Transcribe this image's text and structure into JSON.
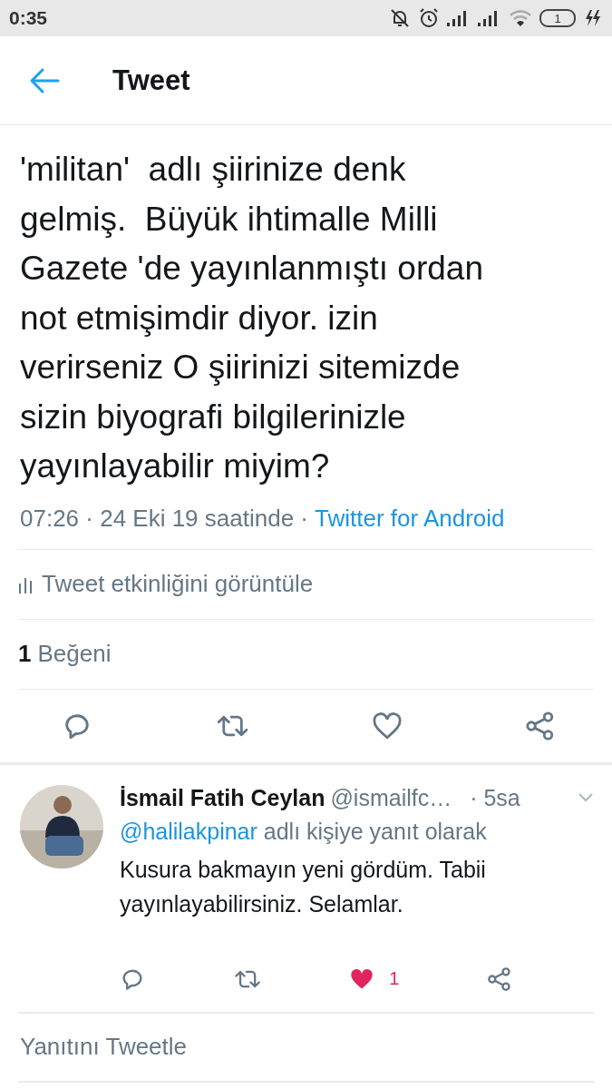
{
  "status_bar": {
    "time": "0:35",
    "battery": "1"
  },
  "header": {
    "title": "Tweet"
  },
  "tweet": {
    "body_lines": [
      "'militan'  adlı şiirinize denk",
      "gelmiş.  Büyük ihtimalle Milli",
      "Gazete 'de yayınlanmıştı ordan",
      "not etmişimdir diyor. izin",
      "verirseniz O şiirinizi sitemizde",
      "sizin biyografi bilgilerinizle",
      "yayınlayabilir miyim?"
    ],
    "timestamp": "07:26 · 24 Eki 19 saatinde ·",
    "source": "Twitter for Android",
    "activity_link": "Tweet etkinliğini görüntüle",
    "like_count": "1",
    "like_label": "Beğeni",
    "liked": false
  },
  "reply": {
    "name": "İsmail Fatih Ceylan",
    "handle": "@ismailfc…",
    "time": "· 5sa",
    "reply_to_handle": "@halilakpinar",
    "reply_to_text": "adlı kişiye yanıt olarak",
    "body": "Kusura bakmayın yeni gördüm. Tabii yayınlayabilirsiniz. Selamlar.",
    "liked": true,
    "like_count": "1"
  },
  "compose": {
    "placeholder": "Yanıtını Tweetle"
  }
}
